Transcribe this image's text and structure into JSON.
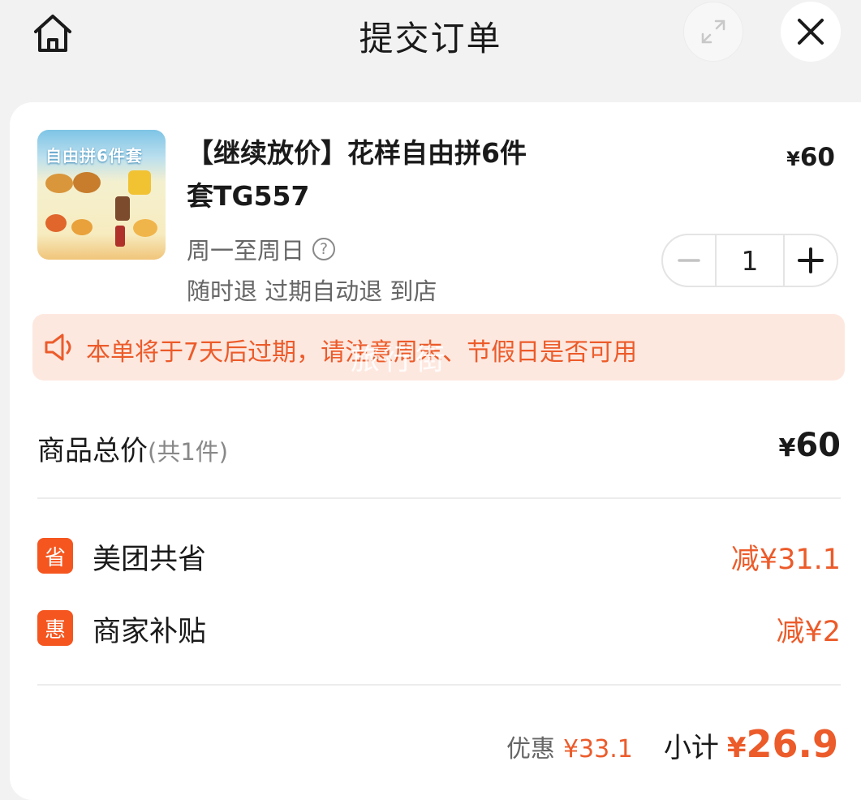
{
  "header": {
    "title": "提交订单",
    "home_icon": "home-icon",
    "expand_icon": "expand-icon",
    "close_icon": "close-icon"
  },
  "product": {
    "thumbnail_text": "自由拼6件套",
    "name_line1": "【继续放价】花样自由拼6件",
    "name_line2": "套TG557",
    "price_symbol": "¥",
    "price": "60",
    "validity": "周一至周日",
    "policy": "随时退 过期自动退 到店",
    "quantity": "1"
  },
  "notice": {
    "text": "本单将于7天后过期，请注意周末、节假日是否可用",
    "watermark": "旅行街"
  },
  "total": {
    "label": "商品总价",
    "count": "(共1件)",
    "symbol": "¥",
    "value": "60"
  },
  "discounts": [
    {
      "badge": "省",
      "label": "美团共省",
      "value": "减¥31.1"
    },
    {
      "badge": "惠",
      "label": "商家补贴",
      "value": "减¥2"
    }
  ],
  "summary": {
    "discount_label": "优惠",
    "discount_value": "¥33.1",
    "subtotal_label": "小计",
    "subtotal_symbol": "¥",
    "subtotal_value": "26.9"
  },
  "colors": {
    "accent": "#ec5b2a",
    "badge": "#f5561f",
    "notice_bg": "#fde8e0"
  }
}
